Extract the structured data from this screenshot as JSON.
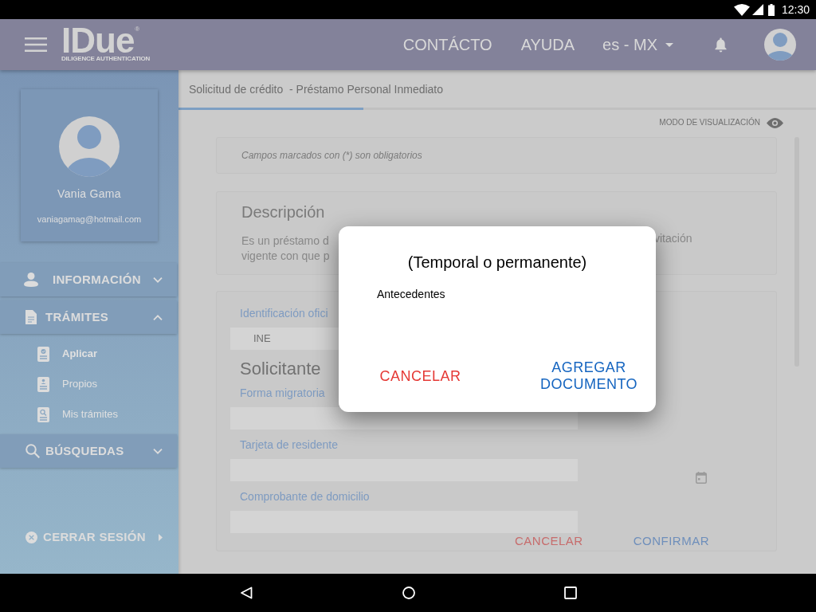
{
  "status_bar": {
    "time": "12:30"
  },
  "top_bar": {
    "logo": {
      "wordmark": "IDue",
      "mark": "®",
      "tagline": "DILIGENCE AUTHENTICATION"
    },
    "nav_links": [
      "CONTÁCTO",
      "AYUDA"
    ],
    "language": "es - MX"
  },
  "sidebar": {
    "profile": {
      "name": "Vania Gama",
      "email": "vaniagamag@hotmail.com"
    },
    "sections": [
      {
        "label": "INFORMACIÓN",
        "expanded": false
      },
      {
        "label": "TRÁMITES",
        "expanded": true,
        "items": [
          {
            "label": "Aplicar",
            "selected": true
          },
          {
            "label": "Propios",
            "selected": false
          },
          {
            "label": "Mis trámites",
            "selected": false
          }
        ]
      },
      {
        "label": "BÚSQUEDAS",
        "expanded": false
      }
    ],
    "logout": "CERRAR SESIÓN"
  },
  "header": {
    "title": "Solicitud de crédito  - Préstamo Personal Inmediato",
    "progress": {
      "level": 0.29
    },
    "view_mode": "MODO DE VISUALIZACIÓN"
  },
  "notice": "Campos marcados con (*) son obligatorios",
  "description": {
    "title": "Descripción",
    "lines": [
      {
        "left": "Es un préstamo d",
        "right": "vitación"
      },
      {
        "left": "vigente con que p"
      }
    ]
  },
  "form": {
    "items": [
      {
        "kind": "field",
        "label": "Identificación ofici",
        "value": "INE"
      },
      {
        "kind": "heading",
        "text": "Solicitante"
      },
      {
        "kind": "field",
        "label": "Forma migratoria"
      },
      {
        "kind": "field",
        "label": "Tarjeta de residente",
        "calendar": true
      },
      {
        "kind": "field",
        "label": "Comprobante de domicilio"
      }
    ],
    "buttons": [
      {
        "kind": "cancel",
        "label": "CANCELAR"
      },
      {
        "kind": "confirm",
        "label": "CONFIRMAR"
      }
    ]
  },
  "dialog": {
    "title": "(Temporal o permanente)",
    "text": "Antecedentes",
    "buttons": [
      {
        "kind": "cancel",
        "label": "CANCELAR"
      },
      {
        "kind": "confirm",
        "label": "AGREGAR DOCUMENTO"
      }
    ]
  }
}
